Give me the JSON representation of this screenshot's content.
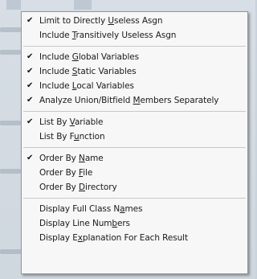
{
  "menu": {
    "groups": [
      {
        "items": [
          {
            "pre": "Limit to Directly ",
            "u": "U",
            "post": "seless Asgn",
            "checked": true
          },
          {
            "pre": "Include ",
            "u": "T",
            "post": "ransitively Useless Asgn",
            "checked": false
          }
        ]
      },
      {
        "items": [
          {
            "pre": "Include ",
            "u": "G",
            "post": "lobal Variables",
            "checked": true
          },
          {
            "pre": "Include ",
            "u": "S",
            "post": "tatic Variables",
            "checked": true
          },
          {
            "pre": "Include ",
            "u": "L",
            "post": "ocal Variables",
            "checked": true
          },
          {
            "pre": "Analyze Union/Bitfield ",
            "u": "M",
            "post": "embers Separately",
            "checked": true
          }
        ]
      },
      {
        "items": [
          {
            "pre": "List By ",
            "u": "V",
            "post": "ariable",
            "checked": true
          },
          {
            "pre": "List By F",
            "u": "u",
            "post": "nction",
            "checked": false
          }
        ]
      },
      {
        "items": [
          {
            "pre": "Order By ",
            "u": "N",
            "post": "ame",
            "checked": true
          },
          {
            "pre": "Order By ",
            "u": "F",
            "post": "ile",
            "checked": false
          },
          {
            "pre": "Order By ",
            "u": "D",
            "post": "irectory",
            "checked": false
          }
        ]
      },
      {
        "items": [
          {
            "pre": "Display Full Class N",
            "u": "a",
            "post": "mes",
            "checked": false
          },
          {
            "pre": "Display Line Num",
            "u": "b",
            "post": "ers",
            "checked": false
          },
          {
            "pre": "Display E",
            "u": "x",
            "post": "planation For Each Result",
            "checked": false
          }
        ]
      }
    ],
    "check_glyph": "✔"
  }
}
